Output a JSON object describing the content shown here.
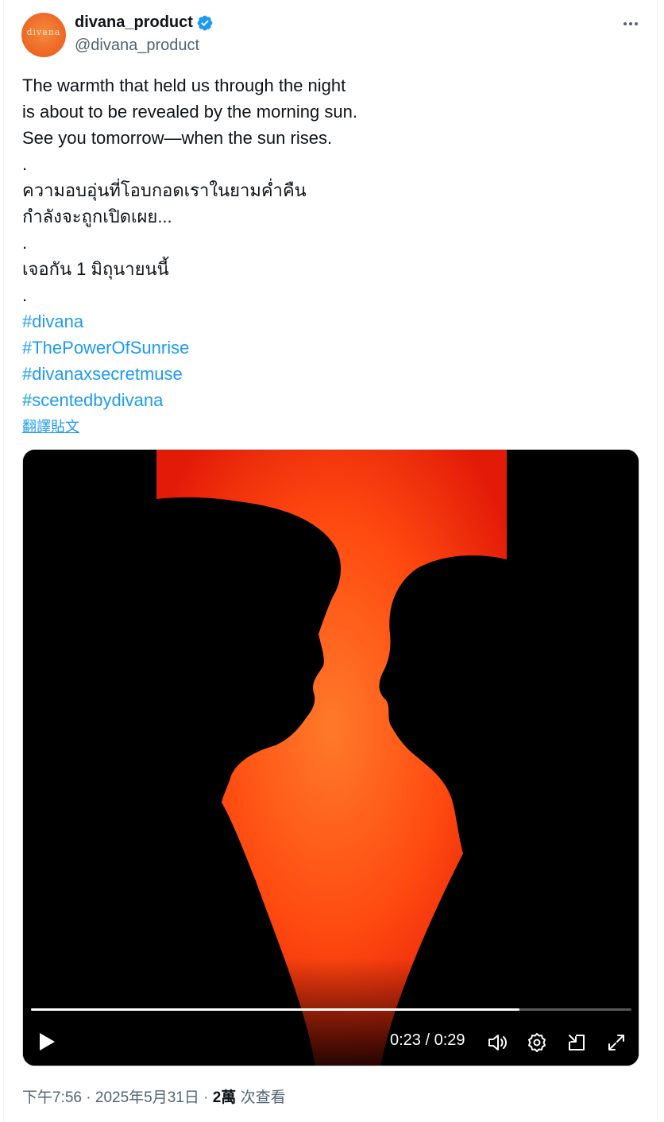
{
  "author": {
    "display_name": "divana_product",
    "handle": "@divana_product",
    "avatar_text": "divana",
    "avatar_subtext": "· · ·"
  },
  "tweet": {
    "lines": [
      {
        "text": "The warmth that held us through the night",
        "type": "text"
      },
      {
        "text": "is about to be revealed by the morning sun.",
        "type": "text"
      },
      {
        "text": "See you tomorrow—when the sun rises.",
        "type": "text"
      },
      {
        "text": ".",
        "type": "text"
      },
      {
        "text": "ความอบอุ่นที่โอบกอดเราในยามค่ำคืน",
        "type": "text"
      },
      {
        "text": "กำลังจะถูกเปิดเผย...",
        "type": "text"
      },
      {
        "text": ".",
        "type": "text"
      },
      {
        "text": "เจอกัน 1 มิถุนายนนี้",
        "type": "text"
      },
      {
        "text": ".",
        "type": "text"
      },
      {
        "text": "#divana",
        "type": "hashtag"
      },
      {
        "text": "#ThePowerOfSunrise",
        "type": "hashtag"
      },
      {
        "text": "#divanaxsecretmuse",
        "type": "hashtag"
      },
      {
        "text": "#scentedbydivana",
        "type": "hashtag"
      }
    ],
    "translate_label": "翻譯貼文"
  },
  "video": {
    "current_time": "0:23",
    "duration": "0:29",
    "time_display": "0:23 / 0:29",
    "progress_fraction": 0.813
  },
  "meta": {
    "time": "下午7:56",
    "date": "2025年5月31日",
    "separator": " · ",
    "views_count": "2萬",
    "views_label": "次查看"
  },
  "colors": {
    "link": "#1d9bf0",
    "verified": "#1d9bf0",
    "secondary_text": "#536471",
    "sunrise_orange": "#ff4a10"
  },
  "icons": [
    "verified-badge-icon",
    "more-icon",
    "play-icon",
    "volume-icon",
    "settings-icon",
    "pip-icon",
    "fullscreen-icon"
  ]
}
